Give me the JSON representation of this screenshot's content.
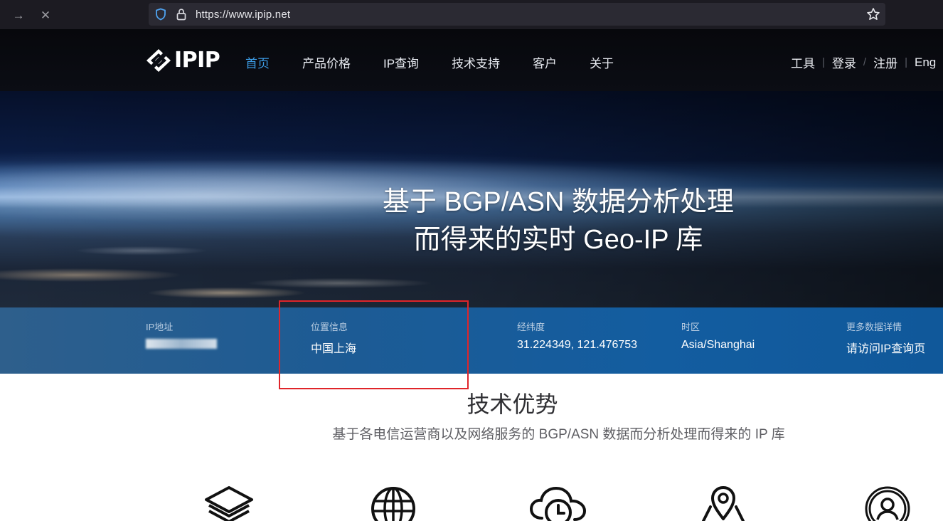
{
  "browser": {
    "url": "https://www.ipip.net"
  },
  "header": {
    "logo_text": "IPIP",
    "nav": [
      {
        "label": "首页",
        "active": true
      },
      {
        "label": "产品价格"
      },
      {
        "label": "IP查询"
      },
      {
        "label": "技术支持"
      },
      {
        "label": "客户"
      },
      {
        "label": "关于"
      }
    ],
    "utility": {
      "tools": "工具",
      "login": "登录",
      "register": "注册",
      "language": "Eng",
      "sep1": "|",
      "sep2": "/",
      "sep3": "|"
    }
  },
  "hero": {
    "line1": "基于 BGP/ASN 数据分析处理",
    "line2": "而得来的实时 Geo-IP 库"
  },
  "info": {
    "ip": {
      "label": "IP地址"
    },
    "location": {
      "label": "位置信息",
      "value": "中国上海"
    },
    "coords": {
      "label": "经纬度",
      "value": "31.224349, 121.476753"
    },
    "timezone": {
      "label": "时区",
      "value": "Asia/Shanghai"
    },
    "more": {
      "label": "更多数据详情",
      "value": "请访问IP查询页"
    }
  },
  "section": {
    "title": "技术优势",
    "subtitle": "基于各电信运营商以及网络服务的 BGP/ASN 数据而分析处理而得来的 IP 库"
  },
  "colors": {
    "accent": "#3d9ee8",
    "highlight": "#e0252a",
    "info_bar": "#135da0"
  },
  "icons": [
    "layers-icon",
    "globe-icon",
    "cloud-clock-icon",
    "location-map-icon",
    "user-circle-icon"
  ]
}
